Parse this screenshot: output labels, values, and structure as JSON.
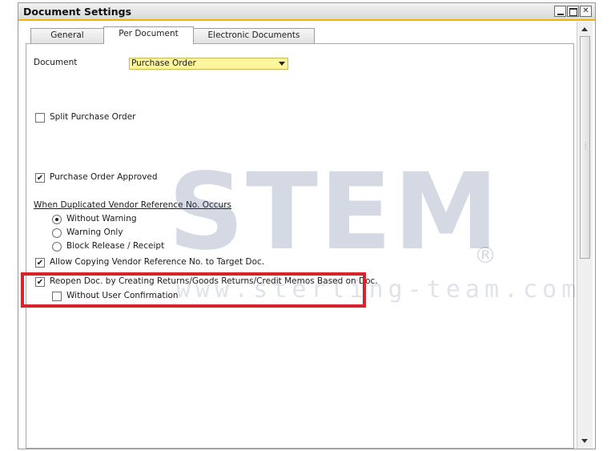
{
  "window": {
    "title": "Document Settings"
  },
  "tabs": [
    {
      "label": "General",
      "active": false
    },
    {
      "label": "Per Document",
      "active": true
    },
    {
      "label": "Electronic Documents",
      "active": false
    }
  ],
  "document": {
    "label": "Document",
    "value": "Purchase Order"
  },
  "split_po": {
    "label": "Split Purchase Order",
    "checked": false
  },
  "po_approved": {
    "label": "Purchase Order Approved",
    "checked": true
  },
  "duplicated_ref": {
    "title": "When Duplicated Vendor Reference No. Occurs",
    "options": [
      {
        "label": "Without Warning",
        "selected": true
      },
      {
        "label": "Warning Only",
        "selected": false
      },
      {
        "label": "Block Release / Receipt",
        "selected": false
      }
    ]
  },
  "allow_copy": {
    "label": "Allow Copying Vendor Reference No. to Target Doc.",
    "checked": true
  },
  "reopen_doc": {
    "label": "Reopen Doc. by Creating Returns/Goods Returns/Credit Memos Based on Doc.",
    "checked": true
  },
  "without_confirm": {
    "label": "Without User Confirmation",
    "checked": false
  },
  "watermark": {
    "logo": "STEM",
    "registered": "®",
    "site": "www.sterling-team.com"
  },
  "colors": {
    "highlight": "#d9222a",
    "combo_bg": "#fff59d",
    "title_accent": "#f0b400"
  },
  "icons": {
    "minimize": "minimize-icon",
    "maximize": "maximize-icon",
    "close": "close-icon"
  }
}
